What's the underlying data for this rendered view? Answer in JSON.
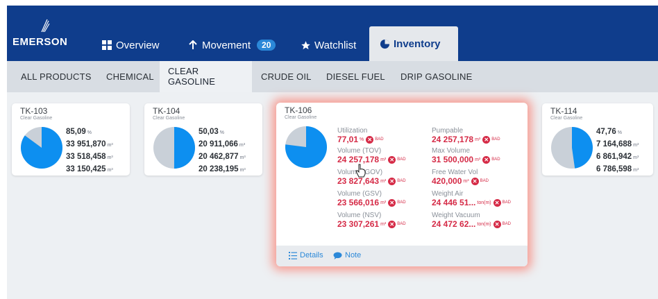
{
  "brand": "EMERSON",
  "nav": {
    "tabs": [
      {
        "label": "Overview",
        "icon": "grid-icon"
      },
      {
        "label": "Movement",
        "icon": "arrow-up-icon",
        "badge": "20"
      },
      {
        "label": "Watchlist",
        "icon": "star-icon"
      },
      {
        "label": "Inventory",
        "icon": "pie-chart-icon",
        "active": true
      }
    ]
  },
  "subtabs": [
    "ALL PRODUCTS",
    "CHEMICAL",
    "CLEAR GASOLINE",
    "CRUDE OIL",
    "DIESEL FUEL",
    "DRIP GASOLINE"
  ],
  "active_subtab": "CLEAR GASOLINE",
  "tanks": [
    {
      "name": "TK-103",
      "product": "Clear Gasoline",
      "fill_pct": 85.09,
      "pct": "85,09",
      "pct_unit": "%",
      "v1": "33 951,870",
      "v2": "33 518,458",
      "v3": "33 150,425",
      "unit": "m³"
    },
    {
      "name": "TK-104",
      "product": "Clear Gasoline",
      "fill_pct": 50.03,
      "pct": "50,03",
      "pct_unit": "%",
      "v1": "20 911,066",
      "v2": "20 462,877",
      "v3": "20 238,195",
      "unit": "m³"
    },
    {
      "name": "TK-114",
      "product": "Clear Gasoline",
      "fill_pct": 47.76,
      "pct": "47,76",
      "pct_unit": "%",
      "v1": "7 164,688",
      "v2": "6 861,942",
      "v3": "6 786,598",
      "unit": "m³"
    }
  ],
  "focus_tank": {
    "name": "TK-106",
    "product": "Clear Gasoline",
    "fill_pct": 77.01,
    "bad_label": "BAD",
    "left": [
      {
        "label": "Utilization",
        "value": "77,01",
        "unit": "%"
      },
      {
        "label": "Volume (TOV)",
        "value": "24 257,178",
        "unit": "m³"
      },
      {
        "label": "Volume (GOV)",
        "value": "23 827,643",
        "unit": "m³"
      },
      {
        "label": "Volume (GSV)",
        "value": "23 566,016",
        "unit": "m³"
      },
      {
        "label": "Volume (NSV)",
        "value": "23 307,261",
        "unit": "m³"
      }
    ],
    "right": [
      {
        "label": "Pumpable",
        "value": "24 257,178",
        "unit": "m³"
      },
      {
        "label": "Max Volume",
        "value": "31 500,000",
        "unit": "m³"
      },
      {
        "label": "Free Water Vol",
        "value": "420,000",
        "unit": "m³"
      },
      {
        "label": "Weight Air",
        "value": "24 446 51...",
        "unit": "ton(m)"
      },
      {
        "label": "Weight Vacuum",
        "value": "24 472 62...",
        "unit": "ton(m)"
      }
    ],
    "details_label": "Details",
    "note_label": "Note"
  },
  "colors": {
    "nav": "#0f3d8c",
    "accent": "#2b88d8",
    "bad": "#d52a46",
    "pie_fill": "#0d8ff0",
    "pie_empty": "#c9d0d8"
  }
}
